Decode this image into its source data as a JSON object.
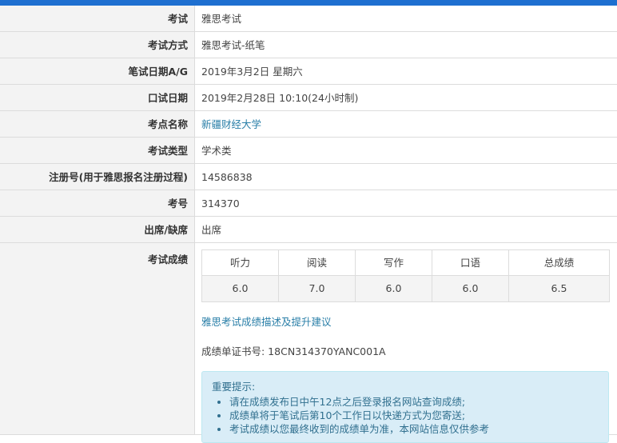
{
  "rows": [
    {
      "label": "考试",
      "value": "雅思考试"
    },
    {
      "label": "考试方式",
      "value": "雅思考试-纸笔"
    },
    {
      "label": "笔试日期A/G",
      "value": "2019年3月2日 星期六"
    },
    {
      "label": "口试日期",
      "value": "2019年2月28日 10:10(24小时制)"
    },
    {
      "label": "考点名称",
      "value": "新疆财经大学"
    },
    {
      "label": "考试类型",
      "value": "学术类"
    },
    {
      "label": "注册号(用于雅思报名注册过程)",
      "value": "14586838"
    },
    {
      "label": "考号",
      "value": "314370"
    },
    {
      "label": "出席/缺席",
      "value": "出席"
    }
  ],
  "scores": {
    "label": "考试成绩",
    "headers": [
      "听力",
      "阅读",
      "写作",
      "口语",
      "总成绩"
    ],
    "values": [
      "6.0",
      "7.0",
      "6.0",
      "6.0",
      "6.5"
    ],
    "description_link": "雅思考试成绩描述及提升建议",
    "certificate": "成绩单证书号: 18CN314370YANC001A"
  },
  "notice": {
    "title": "重要提示:",
    "items": [
      "请在成绩发布日中午12点之后登录报名网站查询成绩;",
      "成绩单将于笔试后第10个工作日以快递方式为您寄送;",
      "考试成绩以您最终收到的成绩单为准，本网站信息仅供参考"
    ]
  },
  "colors": {
    "accent": "#1e6fd0",
    "link": "#2a7fa8",
    "notice_bg": "#d9edf7"
  }
}
